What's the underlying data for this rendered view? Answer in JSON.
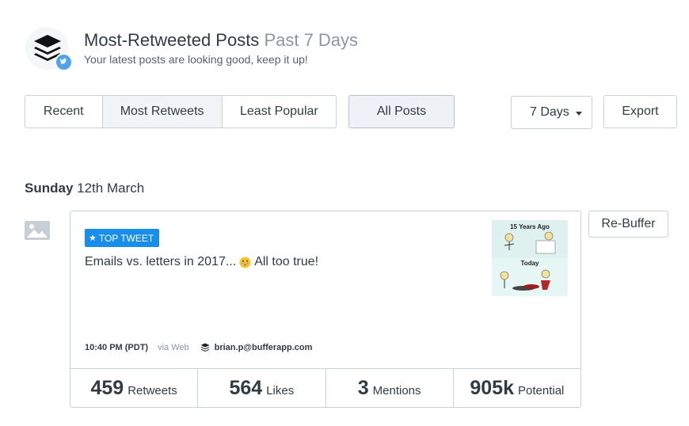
{
  "header": {
    "title": "Most-Retweeted Posts",
    "title_range": "Past 7 Days",
    "subtitle": "Your latest posts are looking good, keep it up!",
    "logo_icon": "buffer-stack-icon",
    "badge_icon": "twitter-bird-icon",
    "badge_color": "#4fa3e8"
  },
  "filters": {
    "segments": [
      {
        "label": "Recent",
        "active": false
      },
      {
        "label": "Most Retweets",
        "active": true
      },
      {
        "label": "Least Popular",
        "active": false
      }
    ],
    "all_posts_label": "All Posts",
    "range_select": {
      "selected": "7 Days"
    },
    "export_label": "Export"
  },
  "day": {
    "weekday": "Sunday",
    "date": "12th March"
  },
  "post": {
    "badge_label": "TOP TWEET",
    "badge_color": "#168eea",
    "text_before": "Emails vs. letters in 2017...",
    "emoji": "grinning-face-emoji",
    "text_after": "All too true!",
    "thumbnail_icon": "comic-thumbnail-image",
    "time": "10:40 PM (PDT)",
    "via": "via Web",
    "account": "brian.p@bufferapp.com",
    "rebuffer_label": "Re-Buffer",
    "stats": [
      {
        "value": "459",
        "label": "Retweets"
      },
      {
        "value": "564",
        "label": "Likes"
      },
      {
        "value": "3",
        "label": "Mentions"
      },
      {
        "value": "905k",
        "label": "Potential"
      }
    ]
  }
}
